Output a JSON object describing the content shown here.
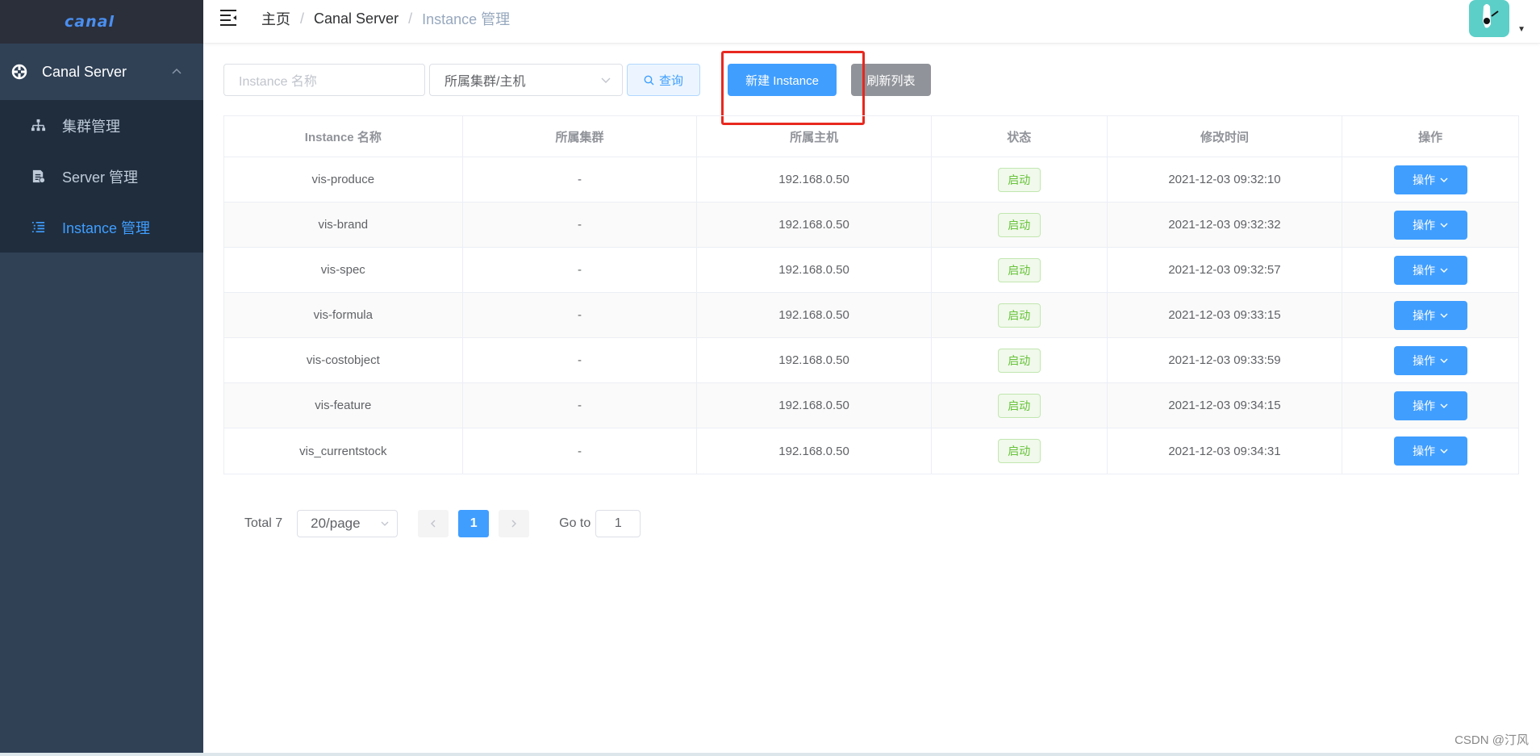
{
  "app": {
    "logo_text": "canal"
  },
  "sidebar": {
    "group_label": "Canal Server",
    "items": [
      {
        "label": "集群管理",
        "icon": "cluster-icon",
        "active": false
      },
      {
        "label": "Server 管理",
        "icon": "server-icon",
        "active": false
      },
      {
        "label": "Instance 管理",
        "icon": "list-icon",
        "active": true
      }
    ]
  },
  "breadcrumb": [
    "主页",
    "Canal Server",
    "Instance 管理"
  ],
  "toolbar": {
    "name_placeholder": "Instance 名称",
    "cluster_select_value": "所属集群/主机",
    "query_label": "查询",
    "new_label": "新建 Instance",
    "refresh_label": "刷新列表"
  },
  "table": {
    "headers": [
      "Instance 名称",
      "所属集群",
      "所属主机",
      "状态",
      "修改时间",
      "操作"
    ],
    "rows": [
      {
        "name": "vis-produce",
        "cluster": "-",
        "host": "192.168.0.50",
        "status": "启动",
        "time": "2021-12-03 09:32:10",
        "action": "操作"
      },
      {
        "name": "vis-brand",
        "cluster": "-",
        "host": "192.168.0.50",
        "status": "启动",
        "time": "2021-12-03 09:32:32",
        "action": "操作"
      },
      {
        "name": "vis-spec",
        "cluster": "-",
        "host": "192.168.0.50",
        "status": "启动",
        "time": "2021-12-03 09:32:57",
        "action": "操作"
      },
      {
        "name": "vis-formula",
        "cluster": "-",
        "host": "192.168.0.50",
        "status": "启动",
        "time": "2021-12-03 09:33:15",
        "action": "操作"
      },
      {
        "name": "vis-costobject",
        "cluster": "-",
        "host": "192.168.0.50",
        "status": "启动",
        "time": "2021-12-03 09:33:59",
        "action": "操作"
      },
      {
        "name": "vis-feature",
        "cluster": "-",
        "host": "192.168.0.50",
        "status": "启动",
        "time": "2021-12-03 09:34:15",
        "action": "操作"
      },
      {
        "name": "vis_currentstock",
        "cluster": "-",
        "host": "192.168.0.50",
        "status": "启动",
        "time": "2021-12-03 09:34:31",
        "action": "操作"
      }
    ]
  },
  "pagination": {
    "total_text": "Total 7",
    "page_size": "20/page",
    "current_page": "1",
    "goto_label": "Go to",
    "goto_value": "1"
  },
  "watermark": "CSDN @汀风",
  "colors": {
    "primary": "#409eff",
    "sidebar": "#304156",
    "success": "#67c23a",
    "highlight": "#e8281f"
  }
}
